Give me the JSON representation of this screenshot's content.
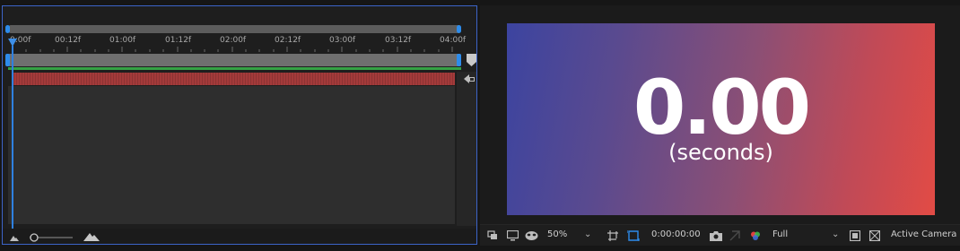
{
  "timeline": {
    "ruler_labels": [
      "0:00f",
      "00:12f",
      "01:00f",
      "01:12f",
      "02:00f",
      "02:12f",
      "03:00f",
      "03:12f",
      "04:00f"
    ],
    "colors": {
      "playhead": "#2f80e0",
      "layer_bar": "#a33a3a",
      "label_green": "#35a245",
      "panel_focus": "#3c64c8"
    },
    "bottom": {
      "zoom_out_icon": "small-mountain-icon",
      "zoom_in_icon": "large-mountain-icon"
    }
  },
  "viewer": {
    "comp": {
      "number": "0.00",
      "caption": "(seconds)",
      "gradient_start": "#3c44a0",
      "gradient_end": "#e24b45"
    },
    "toolbar": {
      "zoom": "50%",
      "timecode": "0:00:00:00",
      "resolution": "Full",
      "camera": "Active Camera"
    }
  }
}
